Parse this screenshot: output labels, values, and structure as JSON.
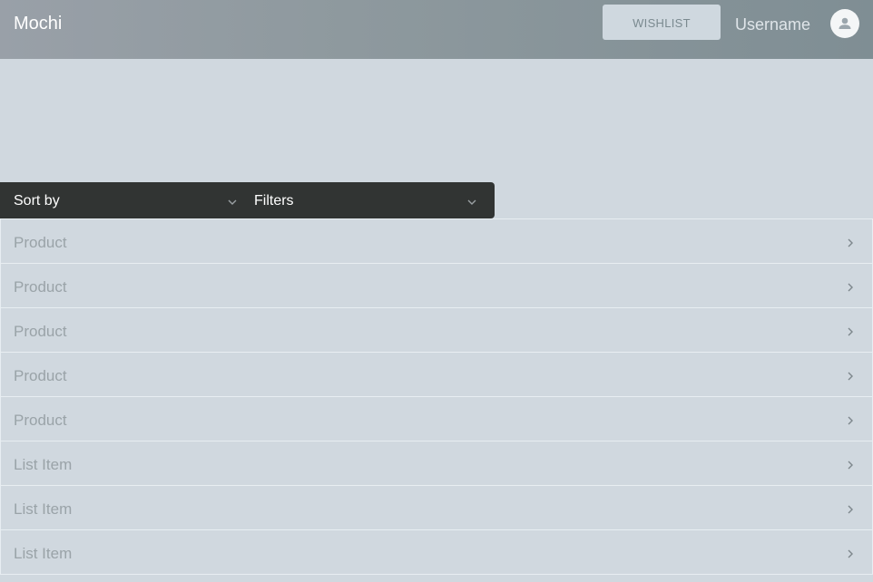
{
  "header": {
    "brand": "Mochi",
    "wishlist_label": "WISHLIST",
    "username": "Username",
    "avatar_icon": "person-icon"
  },
  "controls": {
    "sort_label": "Sort by",
    "filter_label": "Filters"
  },
  "list": {
    "items": [
      {
        "label": "Product"
      },
      {
        "label": "Product"
      },
      {
        "label": "Product"
      },
      {
        "label": "Product"
      },
      {
        "label": "Product"
      },
      {
        "label": "List Item"
      },
      {
        "label": "List Item"
      },
      {
        "label": "List Item"
      }
    ]
  },
  "colors": {
    "header_start": "#99a0a8",
    "header_end": "#7f8e94",
    "page_bg": "#d0d8df",
    "control_bar": "#313433"
  }
}
